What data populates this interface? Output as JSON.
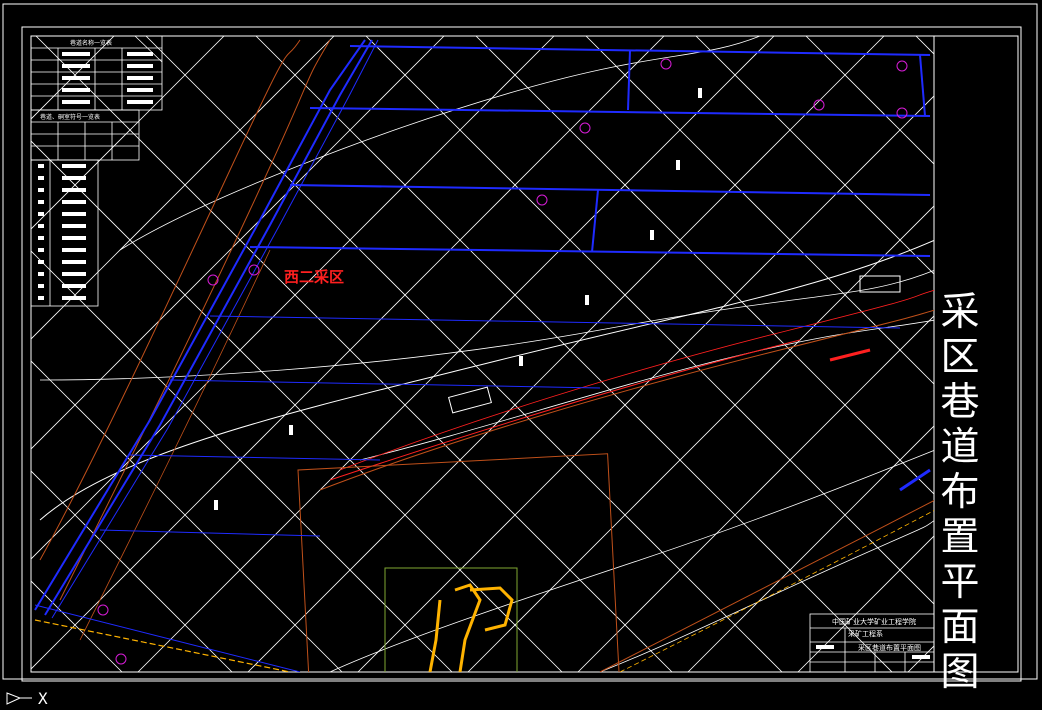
{
  "drawing": {
    "title_chars": [
      "采",
      "区",
      "巷",
      "道",
      "布",
      "置",
      "平",
      "面",
      "图"
    ],
    "area_label": "西二采区",
    "title_block": {
      "line1": "中国矿业大学矿业工程学院",
      "line2": "采矿工程系",
      "line3": "采区巷道布置平面图"
    },
    "legend_table_1_title": "巷道名称一览表",
    "legend_table_2_title": "巷道、硐室符号一览表"
  },
  "colors": {
    "background": "#000000",
    "grid": "#ffffff",
    "roadway": "#1f2bff",
    "contour": "#c0501a",
    "red_roadway": "#ff2020",
    "pillar": "#ffb300",
    "survey_point": "#d61cd6",
    "frame": "#ffffff"
  },
  "icons": {
    "ucs": "ucs-axis-icon",
    "cursor": "crosshair-x-icon"
  }
}
